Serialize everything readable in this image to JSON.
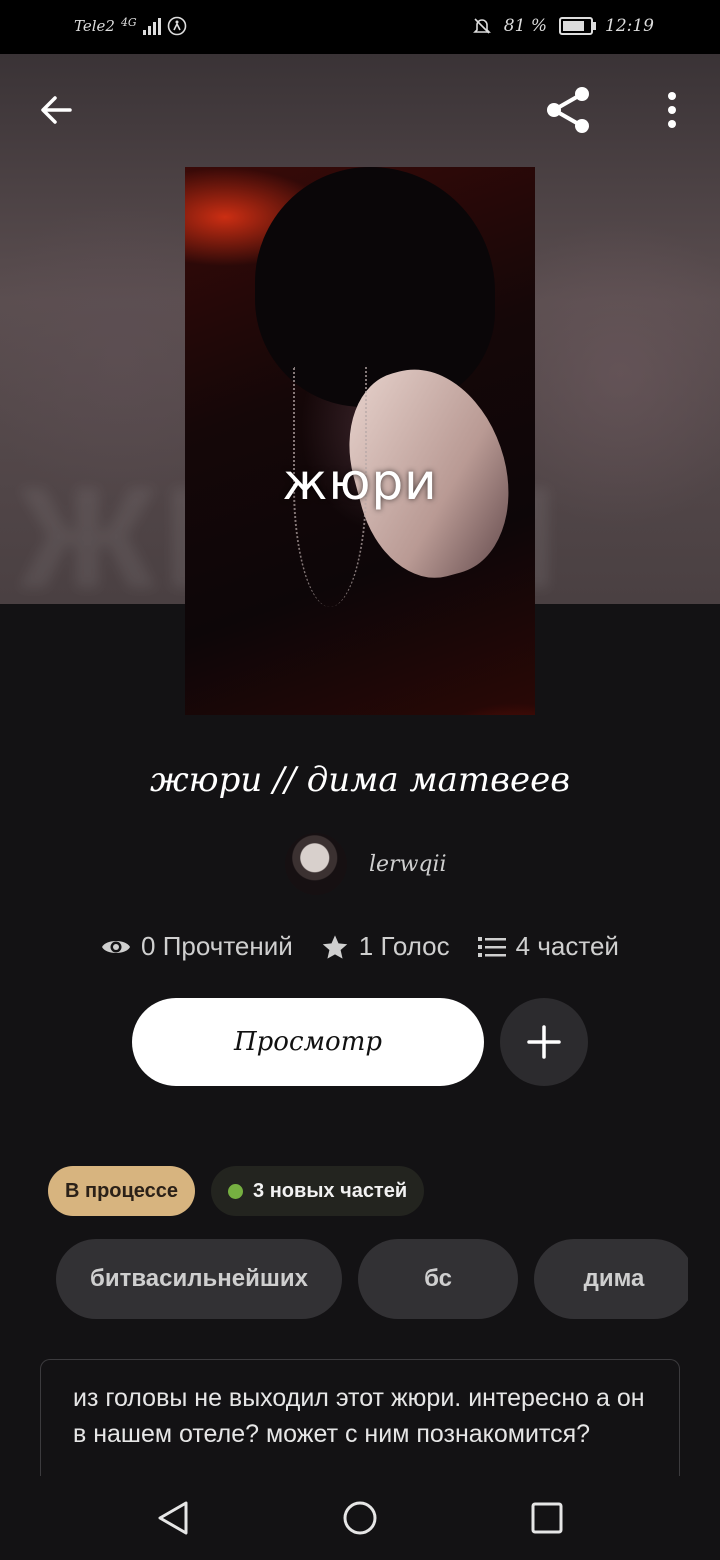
{
  "status_bar": {
    "carrier": "Tele2",
    "network": "4G",
    "battery": "81 %",
    "time": "12:19"
  },
  "hero": {
    "ghost_text": "жюри",
    "cover_title": "жюри"
  },
  "story": {
    "title": "жюри // дима матвеев",
    "author": "lerwqii"
  },
  "stats": {
    "reads": "0 Прочтений",
    "votes": "1 Голос",
    "parts": "4 частей"
  },
  "actions": {
    "read_label": "Просмотр"
  },
  "badges": {
    "status": "В процессе",
    "new_parts": "3 новых частей"
  },
  "tags": [
    "битвасильнейших",
    "бс",
    "дима"
  ],
  "description": "из головы не выходил этот жюри. интересно а он в нашем отеле? может с ним познакомится?",
  "colors": {
    "background": "#131214",
    "status_badge": "#d7b47f",
    "new_dot": "#76b041"
  }
}
